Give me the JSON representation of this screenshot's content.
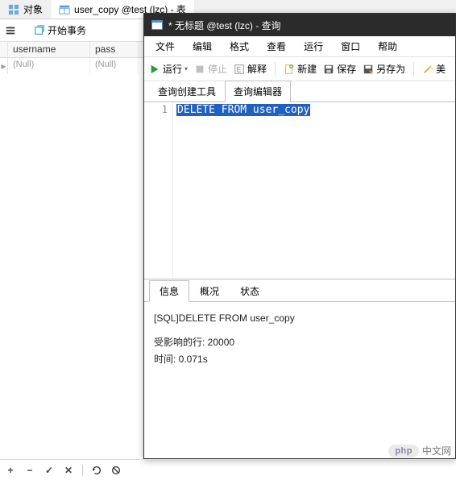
{
  "tabs": {
    "objects": "对象",
    "table": "user_copy @test (lzc) - 表"
  },
  "main_toolbar": {
    "begin_transaction": "开始事务"
  },
  "grid": {
    "headers": {
      "username": "username",
      "pass": "pass"
    },
    "rows": [
      {
        "username": "(Null)",
        "pass": "(Null)"
      }
    ]
  },
  "query_window": {
    "title": "* 无标题 @test (lzc) - 查询",
    "menubar": [
      "文件",
      "编辑",
      "格式",
      "查看",
      "运行",
      "窗口",
      "帮助"
    ],
    "toolbar": {
      "run": "运行",
      "stop": "停止",
      "explain": "解释",
      "new": "新建",
      "save": "保存",
      "save_as": "另存为",
      "beautify": "美"
    },
    "subtabs": {
      "builder": "查询创建工具",
      "editor": "查询编辑器"
    },
    "editor": {
      "line_no": "1",
      "code": "DELETE FROM user_copy"
    },
    "result_tabs": [
      "信息",
      "概况",
      "状态"
    ],
    "result_body": {
      "sql_line": "[SQL]DELETE FROM user_copy",
      "affected": "受影响的行: 20000",
      "time": "时间: 0.071s"
    }
  },
  "watermark": {
    "logo": "php",
    "text": "中文网"
  }
}
